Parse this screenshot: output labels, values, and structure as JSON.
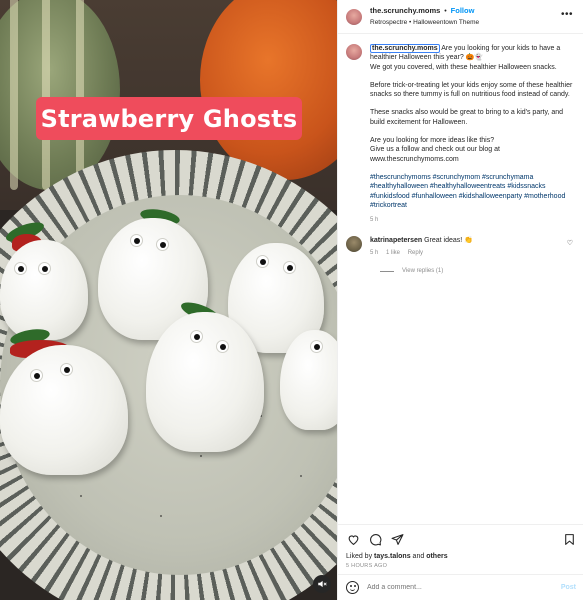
{
  "media": {
    "overlay_title": "Strawberry Ghosts",
    "mute_icon": "speaker-muted-icon"
  },
  "header": {
    "username": "the.scrunchy.moms",
    "separator": "•",
    "follow_label": "Follow",
    "audio": "Retrospectre • Halloweentown Theme",
    "more_icon": "ellipsis-icon"
  },
  "caption": {
    "username": "the.scrunchy.moms",
    "line1": "Are you looking for your kids to have a healthier Halloween this year? 🎃👻",
    "line2": "We got you covered, with these healthier Halloween snacks.",
    "para2": "Before trick-or-treating let your kids enjoy some of these healthier snacks so there tummy is full on nutritious food instead of candy.",
    "para3": "These snacks also would be great to bring to a kid's party, and build excitement for Halloween.",
    "para4a": "Are you looking for more ideas like this?",
    "para4b": "Give us a follow and check out our blog at",
    "para4c": "www.thescrunchymoms.com",
    "hashtags": "#thescrunchymoms #scrunchymom #scrunchymama #healthyhalloween #healthyhalloweentreats #kidssnacks #funkidsfood #funhalloween #kidshalloweenparty #motherhood #trickortreat",
    "age": "5 h"
  },
  "reply": {
    "username": "katrinapetersen",
    "text": "Great ideas! 👏",
    "age": "5 h",
    "likes": "1 like",
    "reply_label": "Reply",
    "view_replies": "View replies (1)"
  },
  "actions": {
    "liked_by_prefix": "Liked by ",
    "liked_by_user": "tays.talons",
    "liked_by_and": " and ",
    "liked_by_others": "others",
    "timestamp": "5 HOURS AGO"
  },
  "add_comment": {
    "placeholder": "Add a comment...",
    "post_label": "Post"
  },
  "colors": {
    "accent": "#0095f6",
    "badge": "#ef4c5c",
    "hashtag": "#00376b"
  }
}
